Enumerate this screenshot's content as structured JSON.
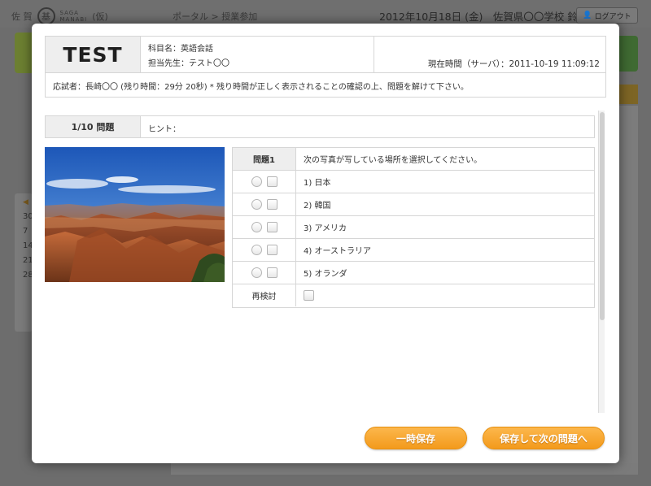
{
  "background": {
    "logo_kanji": "佐 賀",
    "logo_mark": "基",
    "logo_sub_top": "SAGA",
    "logo_sub_bottom": "MANABI",
    "logo_suffix": "(仮)",
    "breadcrumb": "ポータル > 授業参加",
    "header_info": "2012年10月18日 (金)　佐賀県〇〇学校 鈴木",
    "logout_label": "ログアウト",
    "left_list": [
      "30",
      "7",
      "14",
      "21",
      "28"
    ]
  },
  "exam": {
    "title": "TEST",
    "subject": "科目名：英語会話",
    "teacher": "担当先生：テスト〇〇",
    "current_time": "現在時間（サーバ）：2011-10-19 11:09:12",
    "examinee_notice": "応試者：長崎〇〇 (残り時間：29分 20秒) * 残り時間が正しく表示されることの確認の上、問題を解けて下さい。"
  },
  "question": {
    "number_label": "1/10 問題",
    "hint_label": "ヒント：",
    "head_label": "問題1",
    "prompt": "次の写真が写している場所を選択してください。",
    "options": [
      {
        "label": "1) 日本"
      },
      {
        "label": "2) 韓国"
      },
      {
        "label": "3) アメリカ"
      },
      {
        "label": "4) オーストラリア"
      },
      {
        "label": "5) オランダ"
      }
    ],
    "review_label": "再検討"
  },
  "buttons": {
    "temp_save": "一時保存",
    "save_next": "保存して次の問題へ"
  },
  "colors": {
    "accent_orange": "#f39a1c",
    "overlay": "#6d6d6d"
  }
}
